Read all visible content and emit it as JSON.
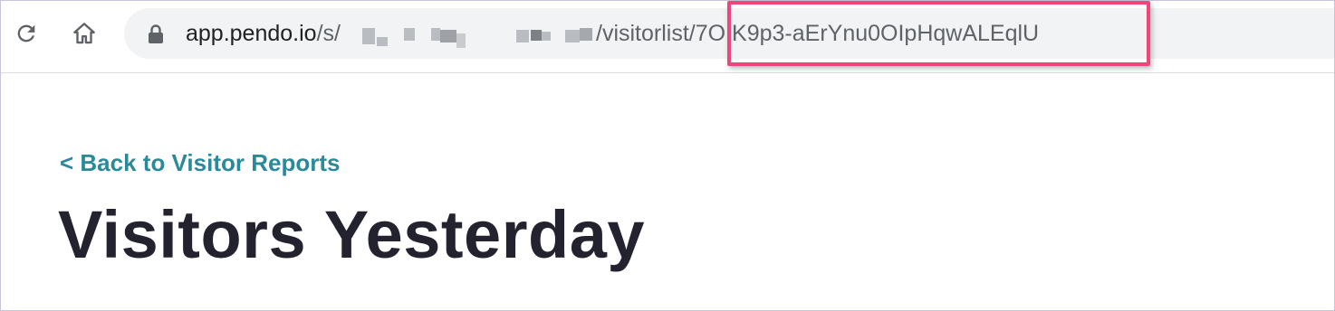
{
  "browser": {
    "url_host": "app.pendo.io",
    "url_path_prefix": "/s/",
    "url_path_middle": "/visitorlist/",
    "url_report_id": "7OIK9p3-aErYnu0OIpHqwALEqlU",
    "icons": {
      "reload": "reload-icon",
      "home": "home-icon",
      "lock": "lock-icon"
    }
  },
  "page": {
    "back_link": "< Back to Visitor Reports",
    "title": "Visitors Yesterday"
  },
  "colors": {
    "link": "#2a8a9a",
    "title": "#23232f",
    "highlight": "#f0457a",
    "omnibox_bg": "#f1f3f4"
  }
}
